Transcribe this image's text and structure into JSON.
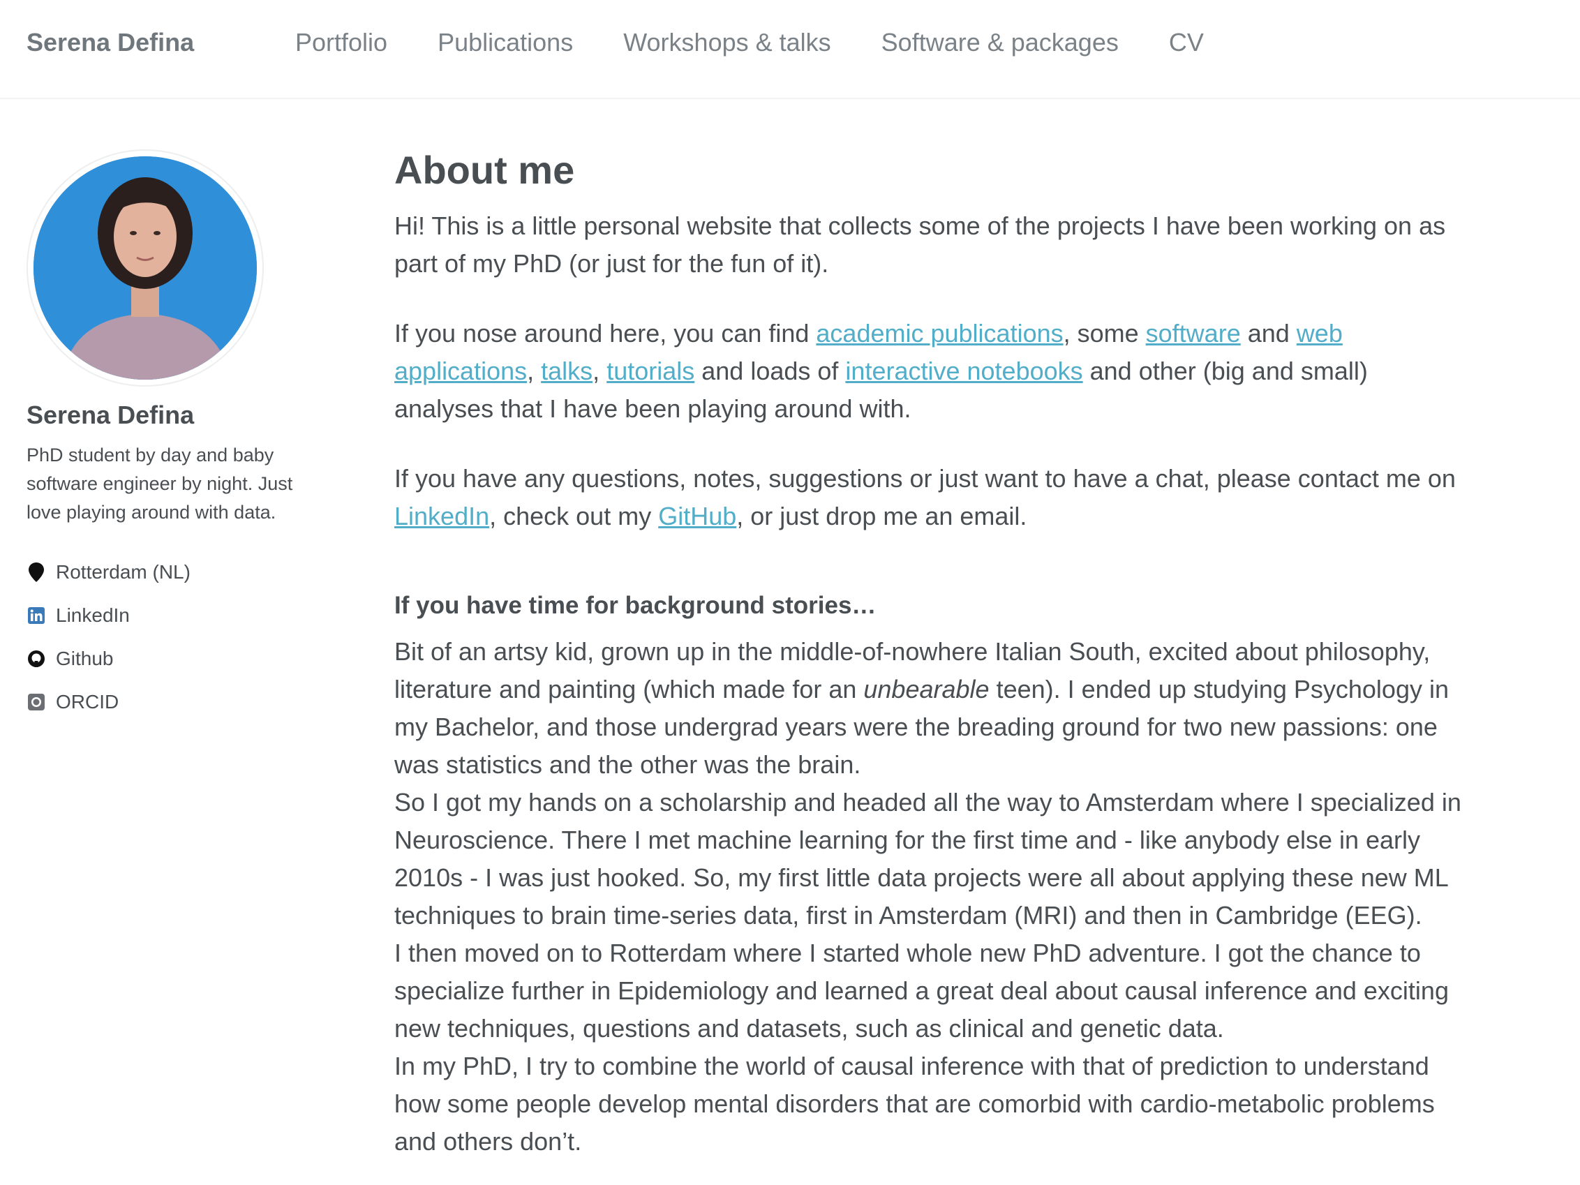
{
  "nav": {
    "site_title": "Serena Defina",
    "links": [
      "Portfolio",
      "Publications",
      "Workshops & talks",
      "Software & packages",
      "CV"
    ]
  },
  "sidebar": {
    "name": "Serena Defina",
    "bio": "PhD student by day and baby software engineer by night. Just love playing around with data.",
    "links": [
      {
        "label": "Rotterdam (NL)",
        "icon": "map-marker-icon"
      },
      {
        "label": "LinkedIn",
        "icon": "linkedin-icon"
      },
      {
        "label": "Github",
        "icon": "github-icon"
      },
      {
        "label": "ORCID",
        "icon": "orcid-icon"
      }
    ]
  },
  "main": {
    "title": "About me",
    "intro": "Hi! This is a little personal website that collects some of the projects I have been working on as part of my PhD (or just for the fun of it).",
    "p2": {
      "t1": "If you nose around here, you can find ",
      "l1": "academic publications",
      "t2": ", some ",
      "l2": "software",
      "t3": " and ",
      "l3": "web applications",
      "t4": ", ",
      "l4": "talks",
      "t5": ", ",
      "l5": "tutorials",
      "t6": " and loads of ",
      "l6": "interactive notebooks",
      "t7": " and other (big and small) analyses that I have been playing around with."
    },
    "p3": {
      "t1": "If you have any questions, notes, suggestions or just want to have a chat, please contact me on ",
      "l1": "LinkedIn",
      "t2": ", check out my ",
      "l2": "GitHub",
      "t3": ", or just drop me an email."
    },
    "subheading": "If you have time for background stories…",
    "story": {
      "s1a": "Bit of an artsy kid, grown up in the middle-of-nowhere Italian South, excited about philosophy, literature and painting (which made for an ",
      "s1em": "unbearable",
      "s1b": " teen). I ended up studying Psychology in my Bachelor, and those undergrad years were the breading ground for two new passions: one was statistics and the other was the brain.",
      "s2": "So I got my hands on a scholarship and headed all the way to Amsterdam where I specialized in Neuroscience. There I met machine learning for the first time and - like anybody else in early 2010s - I was just hooked. So, my first little data projects were all about applying these new ML techniques to brain time-series data, first in Amsterdam (MRI) and then in Cambridge (EEG).",
      "s3": "I then moved on to Rotterdam where I started whole new PhD adventure. I got the chance to specialize further in Epidemiology and learned a great deal about causal inference and exciting new techniques, questions and datasets, such as clinical and genetic data.",
      "s4": "In my PhD, I try to combine the world of causal inference with that of prediction to understand how some people develop mental disorders that are comorbid with cardio-metabolic problems and others don’t."
    }
  },
  "colors": {
    "link": "#52adc8",
    "text": "#494e52",
    "nav": "#7a8288",
    "avatar_bg": "#2f8fd9",
    "linkedin": "#3b7ab8"
  }
}
